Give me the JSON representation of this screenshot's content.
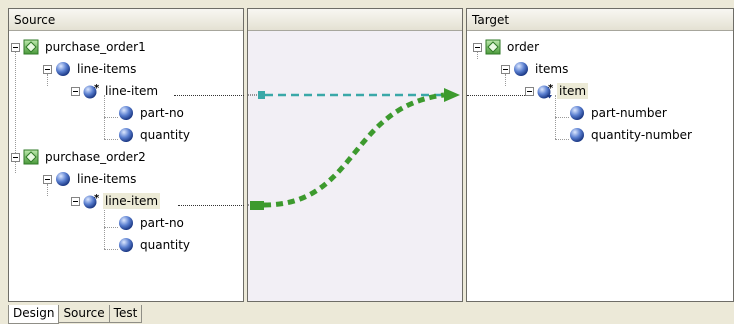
{
  "source_pane": {
    "title": "Source",
    "nodes": [
      {
        "label": "purchase_order1",
        "icon": "schema-root-icon"
      },
      {
        "label": "line-items",
        "icon": "element-icon"
      },
      {
        "label": "line-item",
        "icon": "repeating-element-icon"
      },
      {
        "label": "part-no",
        "icon": "element-icon"
      },
      {
        "label": "quantity",
        "icon": "element-icon"
      },
      {
        "label": "purchase_order2",
        "icon": "schema-root-icon"
      },
      {
        "label": "line-items",
        "icon": "element-icon"
      },
      {
        "label": "line-item",
        "icon": "repeating-element-icon"
      },
      {
        "label": "part-no",
        "icon": "element-icon"
      },
      {
        "label": "quantity",
        "icon": "element-icon"
      }
    ]
  },
  "target_pane": {
    "title": "Target",
    "nodes": [
      {
        "label": "order",
        "icon": "schema-root-icon"
      },
      {
        "label": "items",
        "icon": "element-icon"
      },
      {
        "label": "item",
        "icon": "repeating-element-icon"
      },
      {
        "label": "part-number",
        "icon": "element-icon"
      },
      {
        "label": "quantity-number",
        "icon": "element-icon"
      }
    ]
  },
  "mappings": [
    {
      "from": "purchase_order1/line-items/line-item",
      "to": "order/items/item",
      "color": "#3aa8a8",
      "style": "dashed"
    },
    {
      "from": "purchase_order2/line-items/line-item",
      "to": "order/items/item",
      "color": "#3d9a2e",
      "style": "dashed-bold"
    }
  ],
  "tabs": [
    {
      "label": "Design",
      "active": true
    },
    {
      "label": "Source",
      "active": false
    },
    {
      "label": "Test",
      "active": false
    }
  ],
  "colors": {
    "window_bg": "#ece9d8",
    "mapping_area_bg": "#f2eff5",
    "selection_bg": "#ecead6"
  }
}
